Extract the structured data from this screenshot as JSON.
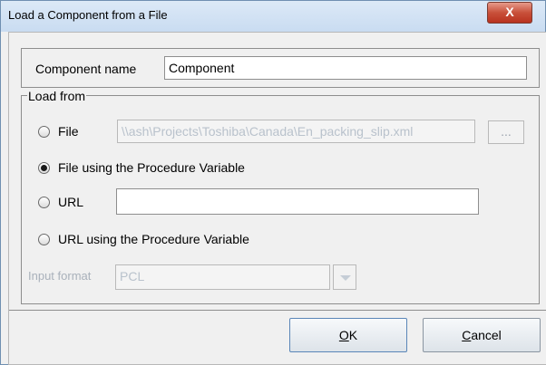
{
  "window": {
    "title": "Load a Component from a File",
    "close_label": "X"
  },
  "component_name": {
    "label": "Component name",
    "value": "Component"
  },
  "load_from": {
    "legend": "Load from",
    "file": {
      "label": "File",
      "path": "\\\\ash\\Projects\\Toshiba\\Canada\\En_packing_slip.xml",
      "browse_label": "...",
      "selected": false,
      "enabled": false
    },
    "file_proc_var": {
      "label": "File using the Procedure Variable",
      "selected": true
    },
    "url": {
      "label": "URL",
      "value": "",
      "selected": false
    },
    "url_proc_var": {
      "label": "URL using the Procedure Variable",
      "selected": false
    },
    "input_format": {
      "label": "Input format",
      "value": "PCL",
      "enabled": false
    }
  },
  "buttons": {
    "ok": {
      "mnemonic": "O",
      "rest": "K"
    },
    "cancel": {
      "mnemonic": "C",
      "rest": "ancel"
    }
  }
}
